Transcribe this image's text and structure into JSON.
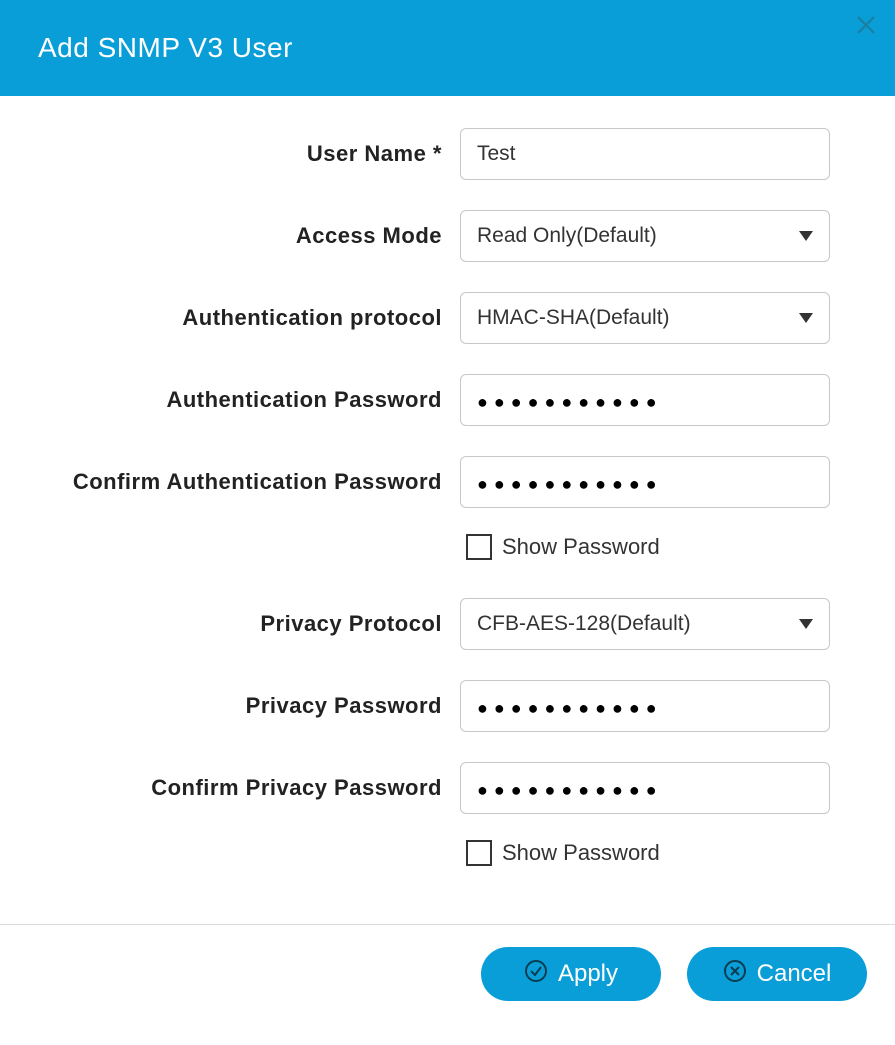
{
  "header": {
    "title": "Add SNMP V3 User"
  },
  "form": {
    "user_name": {
      "label": "User Name *",
      "value": "Test"
    },
    "access_mode": {
      "label": "Access Mode",
      "value": "Read Only(Default)"
    },
    "auth_protocol": {
      "label": "Authentication protocol",
      "value": "HMAC-SHA(Default)"
    },
    "auth_password": {
      "label": "Authentication Password",
      "masked": "●●●●●●●●●●●"
    },
    "confirm_auth_password": {
      "label": "Confirm Authentication Password",
      "masked": "●●●●●●●●●●●"
    },
    "show_auth_password": {
      "label": "Show Password",
      "checked": false
    },
    "privacy_protocol": {
      "label": "Privacy Protocol",
      "value": "CFB-AES-128(Default)"
    },
    "privacy_password": {
      "label": "Privacy Password",
      "masked": "●●●●●●●●●●●"
    },
    "confirm_privacy_password": {
      "label": "Confirm Privacy Password",
      "masked": "●●●●●●●●●●●"
    },
    "show_privacy_password": {
      "label": "Show Password",
      "checked": false
    }
  },
  "footer": {
    "apply": "Apply",
    "cancel": "Cancel"
  }
}
